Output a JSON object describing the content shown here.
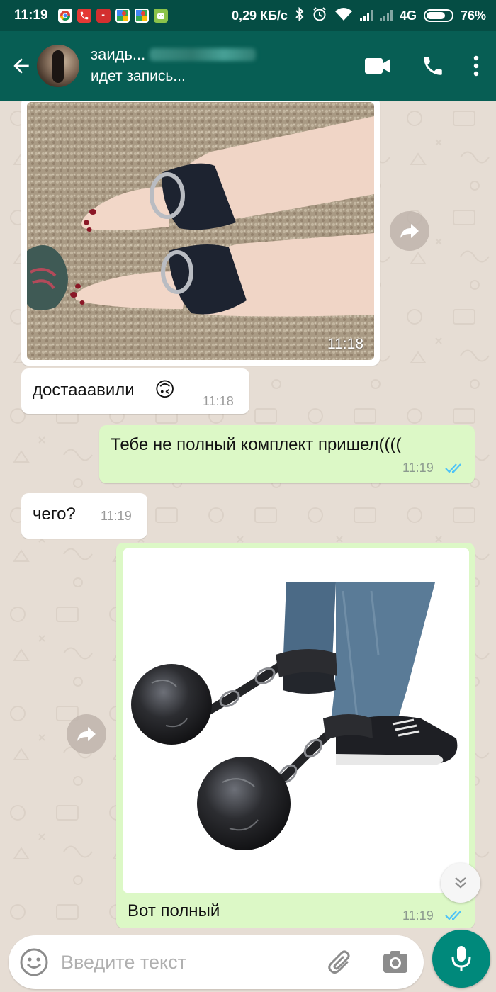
{
  "status_bar": {
    "time": "11:19",
    "network_speed": "0,29 КБ/с",
    "network_type": "4G",
    "battery": "76%",
    "battery_level": 0.76
  },
  "header": {
    "contact_name": "заидь...",
    "contact_status": "идет запись..."
  },
  "messages": [
    {
      "type": "image",
      "direction": "incoming",
      "time": "11:18"
    },
    {
      "type": "text",
      "direction": "incoming",
      "text": "достааавили",
      "emoji": "🙃",
      "time": "11:18"
    },
    {
      "type": "text",
      "direction": "outgoing",
      "text": "Тебе не полный комплект пришел((((",
      "time": "11:19",
      "status": "read"
    },
    {
      "type": "text",
      "direction": "incoming",
      "text": "чего?",
      "time": "11:19"
    },
    {
      "type": "image",
      "direction": "outgoing",
      "caption": "Вот полный",
      "time": "11:19",
      "status": "read"
    }
  ],
  "input": {
    "placeholder": "Введите текст"
  },
  "colors": {
    "header": "#075e54",
    "status_bar": "#054d44",
    "outgoing_bubble": "#dcf8c6",
    "incoming_bubble": "#ffffff",
    "read_ticks": "#4fc3f7",
    "mic_button": "#00897b",
    "chat_background": "#e6ddd4"
  },
  "icons": {
    "back": "arrow-left-icon",
    "video": "video-camera-icon",
    "call": "phone-icon",
    "menu": "more-vertical-icon",
    "forward": "forward-arrow-icon",
    "scroll": "chevron-double-down-icon",
    "emoji": "smiley-icon",
    "attach": "paperclip-icon",
    "camera": "camera-icon",
    "mic": "microphone-icon"
  }
}
